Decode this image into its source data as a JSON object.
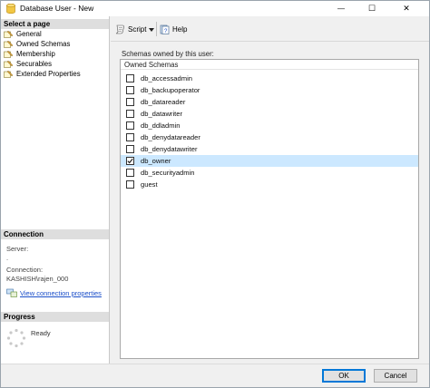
{
  "window": {
    "title": "Database User - New",
    "minimize_glyph": "—",
    "maximize_glyph": "☐",
    "close_glyph": "✕"
  },
  "left": {
    "select_page_header": "Select a page",
    "pages": [
      {
        "label": "General",
        "icon": "wrench-page-icon"
      },
      {
        "label": "Owned Schemas",
        "icon": "wrench-page-icon"
      },
      {
        "label": "Membership",
        "icon": "wrench-page-icon"
      },
      {
        "label": "Securables",
        "icon": "wrench-page-icon"
      },
      {
        "label": "Extended Properties",
        "icon": "wrench-page-icon"
      }
    ],
    "connection_header": "Connection",
    "server_label": "Server:",
    "server_value": ".",
    "connection_label": "Connection:",
    "connection_value": "KASHISH\\rajen_000",
    "view_connection_link": "View connection properties",
    "progress_header": "Progress",
    "progress_status": "Ready"
  },
  "toolbar": {
    "script_label": "Script",
    "help_label": "Help"
  },
  "main": {
    "schemas_label": "Schemas owned by this user:",
    "column_header": "Owned Schemas",
    "schemas": [
      {
        "name": "db_accessadmin",
        "checked": false
      },
      {
        "name": "db_backupoperator",
        "checked": false
      },
      {
        "name": "db_datareader",
        "checked": false
      },
      {
        "name": "db_datawriter",
        "checked": false
      },
      {
        "name": "db_ddladmin",
        "checked": false
      },
      {
        "name": "db_denydatareader",
        "checked": false
      },
      {
        "name": "db_denydatawriter",
        "checked": false
      },
      {
        "name": "db_owner",
        "checked": true,
        "selected": true
      },
      {
        "name": "db_securityadmin",
        "checked": false
      },
      {
        "name": "guest",
        "checked": false
      }
    ]
  },
  "buttons": {
    "ok_label": "OK",
    "cancel_label": "Cancel"
  },
  "colors": {
    "selection": "#cce8ff",
    "link": "#1a4ec9",
    "ok_border": "#0078d7"
  }
}
